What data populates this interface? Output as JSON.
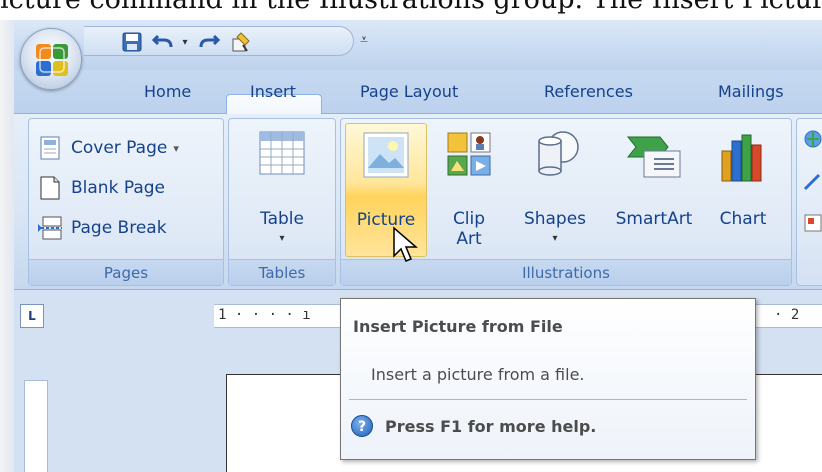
{
  "caption": {
    "text": "icture command in the Illustrations group. The Insert Picture dialog"
  },
  "quick_access": {
    "icons": [
      "save-icon",
      "undo-icon",
      "dropdown-arrow",
      "redo-icon",
      "format-painter-icon"
    ],
    "customize_glyph": "⩡"
  },
  "tabs": [
    {
      "label": "Home"
    },
    {
      "label": "Insert"
    },
    {
      "label": "Page Layout"
    },
    {
      "label": "References"
    },
    {
      "label": "Mailings"
    }
  ],
  "groups": {
    "pages": {
      "label": "Pages",
      "buttons": [
        {
          "label": "Cover Page",
          "caret": "▾",
          "icon": "cover-page-icon"
        },
        {
          "label": "Blank Page",
          "icon": "blank-page-icon"
        },
        {
          "label": "Page Break",
          "icon": "page-break-icon"
        }
      ]
    },
    "tables": {
      "label": "Tables",
      "table": {
        "label": "Table",
        "caret": "▾",
        "icon": "table-icon"
      }
    },
    "illustrations": {
      "label": "Illustrations",
      "picture": {
        "label": "Picture",
        "icon": "picture-icon"
      },
      "clip_art": {
        "label_line1": "Clip",
        "label_line2": "Art",
        "icon": "clip-art-icon"
      },
      "shapes": {
        "label": "Shapes",
        "caret": "▾",
        "icon": "shapes-icon"
      },
      "smartart": {
        "label": "SmartArt",
        "icon": "smartart-icon"
      },
      "chart": {
        "label": "Chart",
        "icon": "chart-icon"
      }
    }
  },
  "ruler": {
    "left_text": "1 · · · · ı",
    "right_text": "· 2"
  },
  "ruler_corner_glyph": "L",
  "tooltip": {
    "title": "Insert Picture from File",
    "description": "Insert a picture from a file.",
    "help_text": "Press F1 for more help.",
    "help_glyph": "?"
  },
  "colors": {
    "ribbon_text": "#15428b",
    "hover_gold": "#ffd35c",
    "tab_bar": "#c6d9f0"
  }
}
